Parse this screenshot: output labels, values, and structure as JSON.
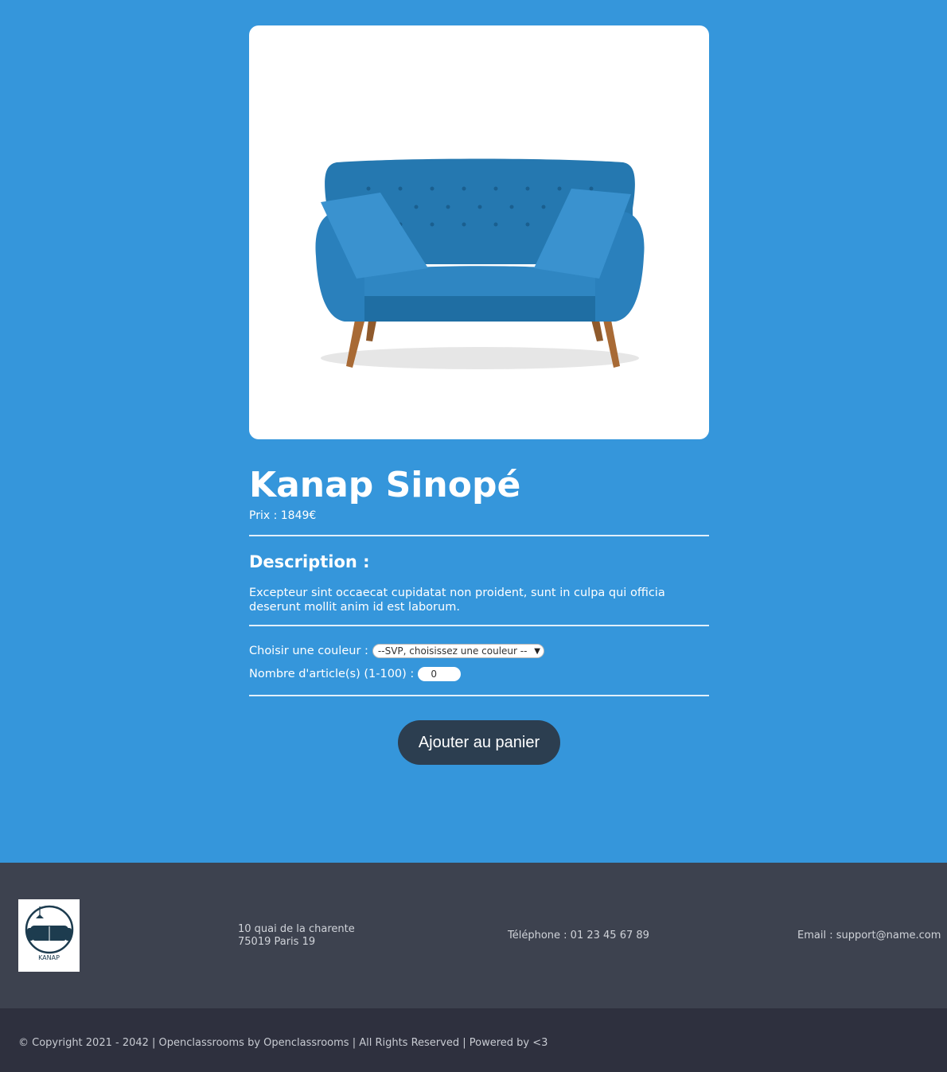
{
  "product": {
    "image_alt": "Canapé bleu",
    "title": "Kanap Sinopé",
    "price_label": "Prix : ",
    "price": "1849",
    "currency": "€",
    "description_title": "Description :",
    "description": "Excepteur sint occaecat cupidatat non proident, sunt in culpa qui officia deserunt mollit anim id est laborum."
  },
  "options": {
    "color_label": "Choisir une couleur :",
    "color_selected": "--SVP, choisissez une couleur --",
    "quantity_label": "Nombre d'article(s) (1-100) :",
    "quantity_value": "0"
  },
  "actions": {
    "add_to_cart": "Ajouter au panier"
  },
  "footer": {
    "logo_text": "KANAP",
    "address_line1": "10 quai de la charente",
    "address_line2": "75019 Paris 19",
    "phone": "Téléphone : 01 23 45 67 89",
    "email": "Email : support@name.com",
    "copyright": "© Copyright 2021 - 2042 | Openclassrooms by Openclassrooms | All Rights Reserved | Powered by <3"
  },
  "colors": {
    "background": "#3596db",
    "button": "#2c3e50",
    "footer": "#3d424f",
    "copyright_bar": "#2e303e",
    "sofa": "#2a7fb8"
  }
}
